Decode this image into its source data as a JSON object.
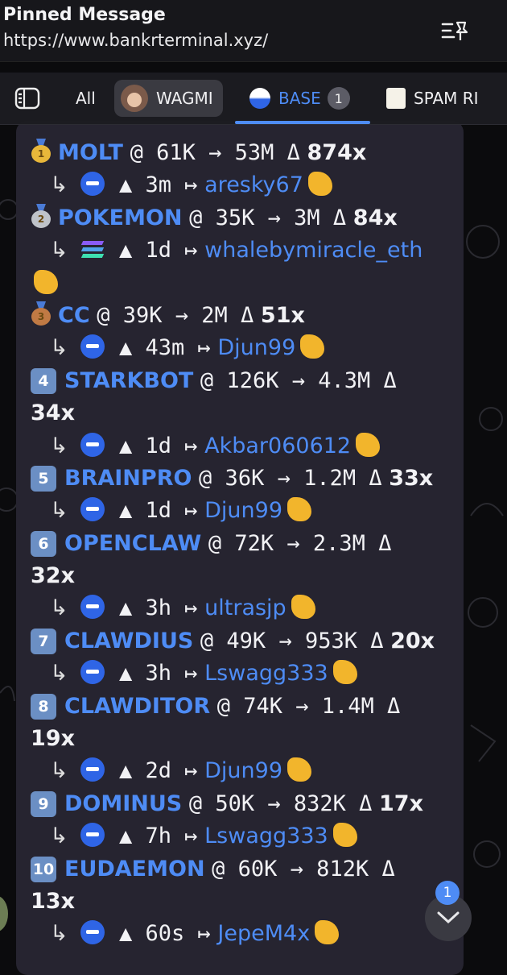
{
  "pinned": {
    "title": "Pinned Message",
    "url": "https://www.bankrterminal.xyz/"
  },
  "tabs": {
    "all": "All",
    "wagmi": "WAGMI",
    "base": "BASE",
    "base_badge": "1",
    "spam": "SPAM RI"
  },
  "colors": {
    "accent": "#4e8cf5",
    "bubble": "#262430",
    "background": "#0b0b0d"
  },
  "entries": [
    {
      "rank": "1",
      "rank_icon": "gold-medal-icon",
      "name": "MOLT",
      "line1_rest": "@ 61K → 53M Δ",
      "mult": "874x",
      "mult_wrap": false,
      "chain": "base",
      "age": "▲ 3m ↦",
      "user": "aresky67",
      "user_wrap": false
    },
    {
      "rank": "2",
      "rank_icon": "silver-medal-icon",
      "name": "POKEMON",
      "line1_rest": "@ 35K → 3M Δ",
      "mult": "84x",
      "mult_wrap": false,
      "chain": "solana",
      "age": "▲ 1d ↦",
      "user": "whalebymiracle_eth",
      "user_wrap": true
    },
    {
      "rank": "3",
      "rank_icon": "bronze-medal-icon",
      "name": "CC",
      "line1_rest": "@ 39K → 2M Δ",
      "mult": "51x",
      "mult_wrap": false,
      "chain": "base",
      "age": "▲ 43m ↦",
      "user": "Djun99",
      "user_wrap": false
    },
    {
      "rank": "4",
      "rank_icon": "keycap-4-icon",
      "name": "STARKBOT",
      "line1_rest": "@ 126K → 4.3M Δ",
      "mult": "34x",
      "mult_wrap": true,
      "chain": "base",
      "age": "▲ 1d ↦",
      "user": "Akbar060612",
      "user_wrap": false
    },
    {
      "rank": "5",
      "rank_icon": "keycap-5-icon",
      "name": "BRAINPRO",
      "line1_rest": "@ 36K → 1.2M Δ",
      "mult": "33x",
      "mult_wrap": false,
      "chain": "base",
      "age": "▲ 1d ↦",
      "user": "Djun99",
      "user_wrap": false
    },
    {
      "rank": "6",
      "rank_icon": "keycap-6-icon",
      "name": "OPENCLAW",
      "line1_rest": "@ 72K → 2.3M Δ",
      "mult": "32x",
      "mult_wrap": true,
      "chain": "base",
      "age": "▲ 3h ↦",
      "user": "ultrasjp",
      "user_wrap": false
    },
    {
      "rank": "7",
      "rank_icon": "keycap-7-icon",
      "name": "CLAWDIUS",
      "line1_rest": "@ 49K → 953K Δ",
      "mult": "20x",
      "mult_wrap": false,
      "chain": "base",
      "age": "▲ 3h ↦",
      "user": "Lswagg333",
      "user_wrap": false
    },
    {
      "rank": "8",
      "rank_icon": "keycap-8-icon",
      "name": "CLAWDITOR",
      "line1_rest": "@ 74K → 1.4M Δ",
      "mult": "19x",
      "mult_wrap": true,
      "chain": "base",
      "age": "▲ 2d ↦",
      "user": "Djun99",
      "user_wrap": false
    },
    {
      "rank": "9",
      "rank_icon": "keycap-9-icon",
      "name": "DOMINUS",
      "line1_rest": "@ 50K → 832K Δ",
      "mult": "17x",
      "mult_wrap": false,
      "chain": "base",
      "age": "▲ 7h ↦",
      "user": "Lswagg333",
      "user_wrap": false
    },
    {
      "rank": "10",
      "rank_icon": "keycap-10-icon",
      "name": "EUDAEMON",
      "line1_rest": "@ 60K → 812K Δ",
      "mult": "13x",
      "mult_wrap": true,
      "chain": "base",
      "age": "▲ 60s ↦",
      "user": "JepeM4x",
      "user_wrap": false
    }
  ],
  "scroll": {
    "badge": "1"
  }
}
